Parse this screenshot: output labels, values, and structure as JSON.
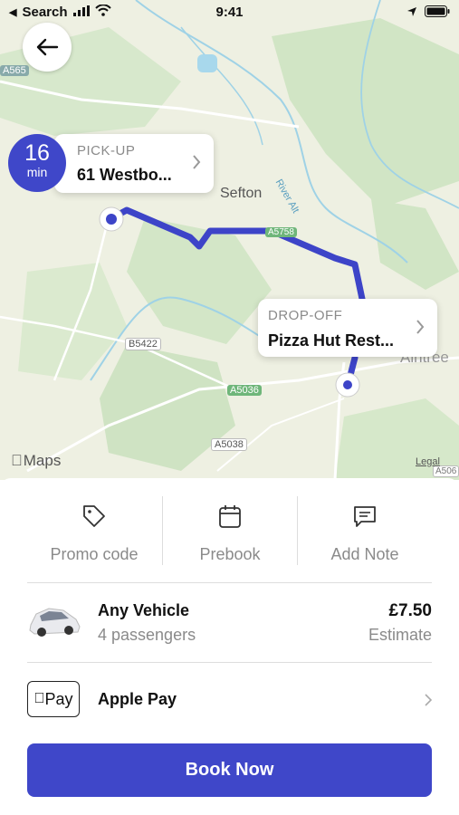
{
  "status_bar": {
    "carrier": "Search",
    "time": "9:41"
  },
  "map": {
    "labels": {
      "town_1": "Sefton",
      "town_2": "Aintree",
      "river": "River Alt",
      "road_a5758": "A5758",
      "road_b5422": "B5422",
      "road_a5036": "A5036",
      "road_a5038": "A5038",
      "road_a506": "A506",
      "road_a565": "A565"
    },
    "attribution": "Maps",
    "legal": "Legal"
  },
  "eta": {
    "value": "16",
    "unit": "min"
  },
  "pickup": {
    "label": "PICK-UP",
    "value": "61 Westbo..."
  },
  "dropoff": {
    "label": "DROP-OFF",
    "value": "Pizza Hut Rest..."
  },
  "options": [
    {
      "label": "Promo code",
      "icon": "tag-icon"
    },
    {
      "label": "Prebook",
      "icon": "calendar-icon"
    },
    {
      "label": "Add Note",
      "icon": "note-icon"
    }
  ],
  "vehicle": {
    "title": "Any Vehicle",
    "passengers": "4 passengers",
    "price": "£7.50",
    "price_note": "Estimate"
  },
  "payment": {
    "badge": "Pay",
    "title": "Apple Pay"
  },
  "book_button": "Book Now",
  "colors": {
    "accent": "#3f47c9",
    "route": "#3d44c8",
    "map_bg": "#eef0e2",
    "green": "#cfe3c3",
    "water": "#9fd2e6"
  }
}
